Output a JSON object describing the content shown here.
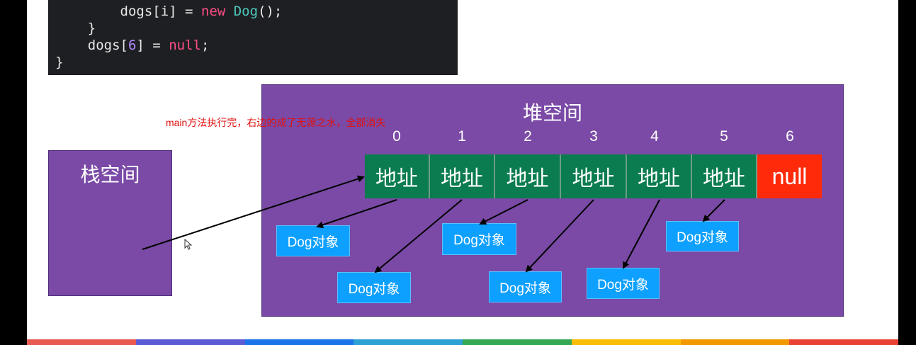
{
  "code": {
    "lines": [
      {
        "indent": "        ",
        "parts": [
          {
            "t": "dogs[i] = ",
            "c": "plain"
          },
          {
            "t": "new",
            "c": "kw"
          },
          {
            "t": " ",
            "c": "plain"
          },
          {
            "t": "Dog",
            "c": "cls"
          },
          {
            "t": "();",
            "c": "plain"
          }
        ]
      },
      {
        "indent": "    ",
        "parts": [
          {
            "t": "}",
            "c": "plain"
          }
        ]
      },
      {
        "indent": "    ",
        "parts": [
          {
            "t": "dogs[",
            "c": "plain"
          },
          {
            "t": "6",
            "c": "num"
          },
          {
            "t": "] = ",
            "c": "plain"
          },
          {
            "t": "null",
            "c": "kw"
          },
          {
            "t": ";",
            "c": "plain"
          }
        ]
      },
      {
        "indent": "",
        "parts": [
          {
            "t": "}",
            "c": "plain"
          }
        ]
      }
    ]
  },
  "stack": {
    "title": "栈空间"
  },
  "heap": {
    "title": "堆空间",
    "indices": [
      "0",
      "1",
      "2",
      "3",
      "4",
      "5",
      "6"
    ],
    "cells": [
      "地址",
      "地址",
      "地址",
      "地址",
      "地址",
      "地址",
      "null"
    ]
  },
  "dog_label": "Dog对象",
  "annotation": "main方法执行完，右边的成了无源之水，全部消失",
  "colors": {
    "purple": "#7a4aa6",
    "green": "#0a7c4f",
    "red": "#ff2a0a",
    "blue": "#0ea0ff",
    "annotation": "#e01010"
  }
}
